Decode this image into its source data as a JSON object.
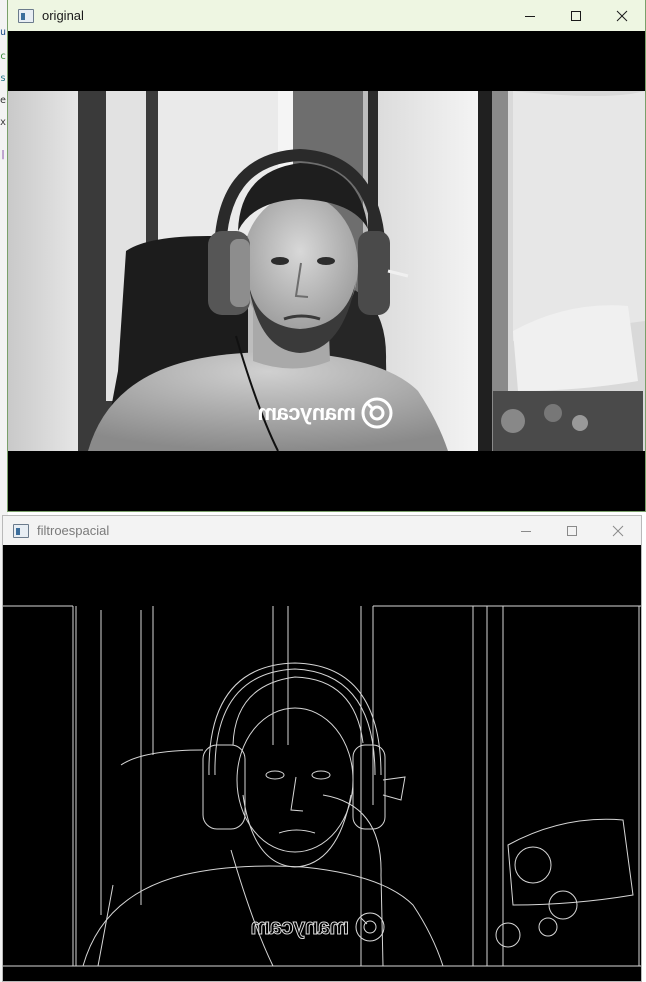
{
  "windows": [
    {
      "id": "original",
      "title": "original",
      "active": true,
      "titlebar_color": "#eef6e2",
      "content": "grayscale webcam frame of a man wearing headphones",
      "watermark": "manycam"
    },
    {
      "id": "filtroespacial",
      "title": "filtroespacial",
      "active": false,
      "titlebar_color": "#f3f3f3",
      "content": "edge-detected (spatial filter) webcam frame",
      "watermark": "manycam"
    }
  ],
  "icons": {
    "app": "window-app-icon",
    "minimize": "minimize-icon",
    "maximize": "maximize-icon",
    "close": "close-icon"
  },
  "colors": {
    "video_background": "#000000",
    "active_border": "#7aa06a",
    "inactive_border": "#b9b9b9"
  }
}
